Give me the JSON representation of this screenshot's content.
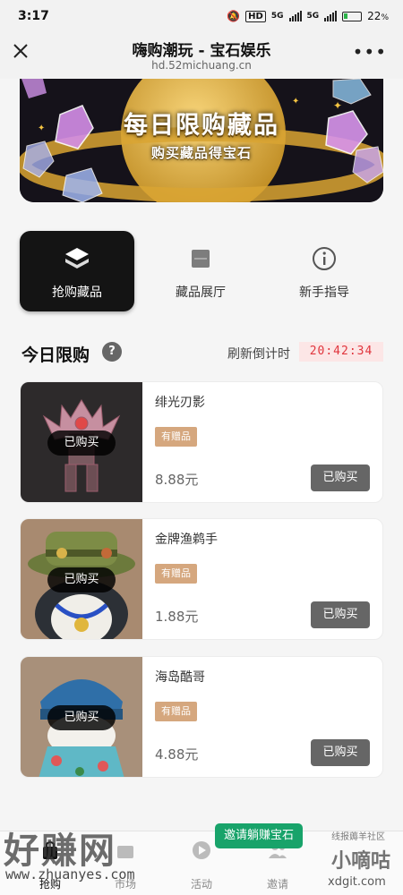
{
  "status": {
    "time": "3:17",
    "hd": "HD",
    "sig1": "5G",
    "sig2": "5G",
    "battery": "22",
    "pct": "%"
  },
  "nav": {
    "title": "嗨购潮玩 - 宝石娱乐",
    "url": "hd.52michuang.cn",
    "close_icon": "close-icon",
    "more_icon": "more-icon",
    "more": "•••"
  },
  "banner": {
    "title": "每日限购藏品",
    "subtitle": "购买藏品得宝石"
  },
  "entries": [
    {
      "label": "抢购藏品",
      "icon": "stack-icon",
      "active": true
    },
    {
      "label": "藏品展厅",
      "icon": "gallery-icon",
      "active": false
    },
    {
      "label": "新手指导",
      "icon": "info-icon",
      "active": false
    }
  ],
  "section": {
    "title": "今日限购",
    "help": "?",
    "countdown_label": "刷新倒计时",
    "countdown": "20:42:34"
  },
  "products": [
    {
      "name": "绯光刃影",
      "gift": "有赠品",
      "price": "8.88元",
      "status": "已购买",
      "button": "已购买"
    },
    {
      "name": "金牌渔鹈手",
      "gift": "有赠品",
      "price": "1.88元",
      "status": "已购买",
      "button": "已购买"
    },
    {
      "name": "海岛酷哥",
      "gift": "有赠品",
      "price": "4.88元",
      "status": "已购买",
      "button": "已购买"
    }
  ],
  "tabbar": {
    "tabs": [
      {
        "label": "抢购",
        "active": true
      },
      {
        "label": "市场",
        "active": false
      },
      {
        "label": "活动",
        "active": false
      },
      {
        "label": "邀请",
        "active": false
      }
    ],
    "invite_badge": "邀请躺赚宝石"
  },
  "watermarks": {
    "left_text": "好赚网",
    "left_url": "www.zhuanyes.com",
    "right_small": "线报薅羊社区",
    "right_text": "小嘀咕",
    "right_url": "xdgit.com"
  },
  "colors": {
    "timer_bg": "#fce6e6",
    "timer_text": "#e0353d",
    "gift_bg": "#d5a77e",
    "invite_bg": "#18a36a"
  }
}
